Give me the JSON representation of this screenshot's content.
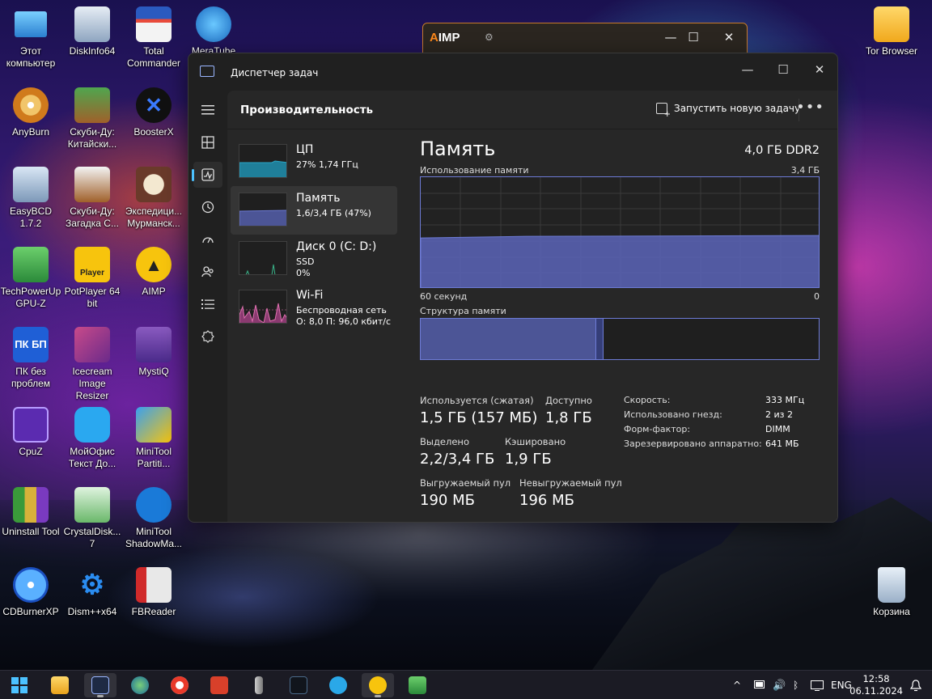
{
  "desktop": {
    "icons": [
      {
        "label": "Этот компьютер"
      },
      {
        "label": "DiskInfo64"
      },
      {
        "label": "Total Commander"
      },
      {
        "label": "MeraTube"
      },
      {
        "label": "AnyBurn"
      },
      {
        "label": "Скуби-Ду: Китайски..."
      },
      {
        "label": "BoosterX"
      },
      {
        "label": "EasyBCD 1.7.2"
      },
      {
        "label": "Скуби-Ду: Загадка С..."
      },
      {
        "label": "Экспедици... Мурманск..."
      },
      {
        "label": "TechPowerUp GPU-Z"
      },
      {
        "label": "PotPlayer 64 bit"
      },
      {
        "label": "AIMP"
      },
      {
        "label": "ПК без проблем"
      },
      {
        "label": "Icecream Image Resizer"
      },
      {
        "label": "MystiQ"
      },
      {
        "label": "CpuZ"
      },
      {
        "label": "МойОфис Текст До..."
      },
      {
        "label": "MiniTool Partiti..."
      },
      {
        "label": "Uninstall Tool"
      },
      {
        "label": "CrystalDisk... 7"
      },
      {
        "label": "MiniTool ShadowMa..."
      },
      {
        "label": "CDBurnerXP"
      },
      {
        "label": "Dism++x64"
      },
      {
        "label": "FBReader"
      },
      {
        "label": "Tor Browser"
      },
      {
        "label": "Корзина"
      }
    ],
    "potplayer_badge": "Player",
    "pk_badge": "ПК БП"
  },
  "aimp": {
    "logo_a": "A",
    "logo_rest": "IMP",
    "gear": "⚙",
    "min": "—",
    "max": "☐",
    "close": "✕"
  },
  "taskmgr": {
    "title": "Диспетчер задач",
    "min": "—",
    "max": "☐",
    "close": "✕",
    "section_title": "Производительность",
    "run_new_task": "Запустить новую задачу",
    "more": "•••",
    "items": [
      {
        "name": "ЦП",
        "sub1": "27% 1,74 ГГц",
        "sub2": ""
      },
      {
        "name": "Память",
        "sub1": "1,6/3,4 ГБ (47%)",
        "sub2": ""
      },
      {
        "name": "Диск 0 (C: D:)",
        "sub1": "SSD",
        "sub2": "0%"
      },
      {
        "name": "Wi-Fi",
        "sub1": "Беспроводная сеть",
        "sub2": "О: 8,0 П: 96,0 кбит/с"
      }
    ],
    "memory": {
      "heading": "Память",
      "capacity": "4,0 ГБ DDR2",
      "usage_label": "Использование памяти",
      "usage_max": "3,4 ГБ",
      "time_left": "60 секунд",
      "time_right": "0",
      "usage_fraction": 0.47,
      "structure_label": "Структура памяти",
      "structure_used_fraction": 0.44,
      "structure_modified_fraction": 0.02,
      "stats": [
        {
          "label": "Используется (сжатая)",
          "value": "1,5 ГБ (157 МБ)"
        },
        {
          "label": "Доступно",
          "value": "1,8 ГБ"
        },
        {
          "label": "Выделено",
          "value": "2,2/3,4 ГБ"
        },
        {
          "label": "Кэшировано",
          "value": "1,9 ГБ"
        },
        {
          "label": "Выгружаемый пул",
          "value": "190 МБ"
        },
        {
          "label": "Невыгружаемый пул",
          "value": "196 МБ"
        }
      ],
      "details": [
        {
          "key": "Скорость:",
          "value": "333 МГц"
        },
        {
          "key": "Использовано гнезд:",
          "value": "2 из 2"
        },
        {
          "key": "Форм-фактор:",
          "value": "DIMM"
        },
        {
          "key": "Зарезервировано аппаратно:",
          "value": "641 МБ"
        }
      ]
    }
  },
  "taskbar": {
    "apps": [
      "start",
      "file-explorer",
      "task-manager",
      "browser-globe",
      "yandex-browser",
      "power-app",
      "usb-tool",
      "fan-app",
      "telegram",
      "aimp",
      "gpu-z"
    ],
    "tray": {
      "chevron": "^",
      "lang": "ENG",
      "volume": "🔊",
      "bluetooth": "ᛒ"
    },
    "time": "12:58",
    "date": "06.11.2024",
    "bell": "🔔"
  },
  "colors": {
    "accent": "#4cc2ff",
    "memory_fill": "#5a64b8",
    "memory_border": "#6d7bd6",
    "cpu": "#2aa6c5",
    "wifi": "#e070b0"
  }
}
